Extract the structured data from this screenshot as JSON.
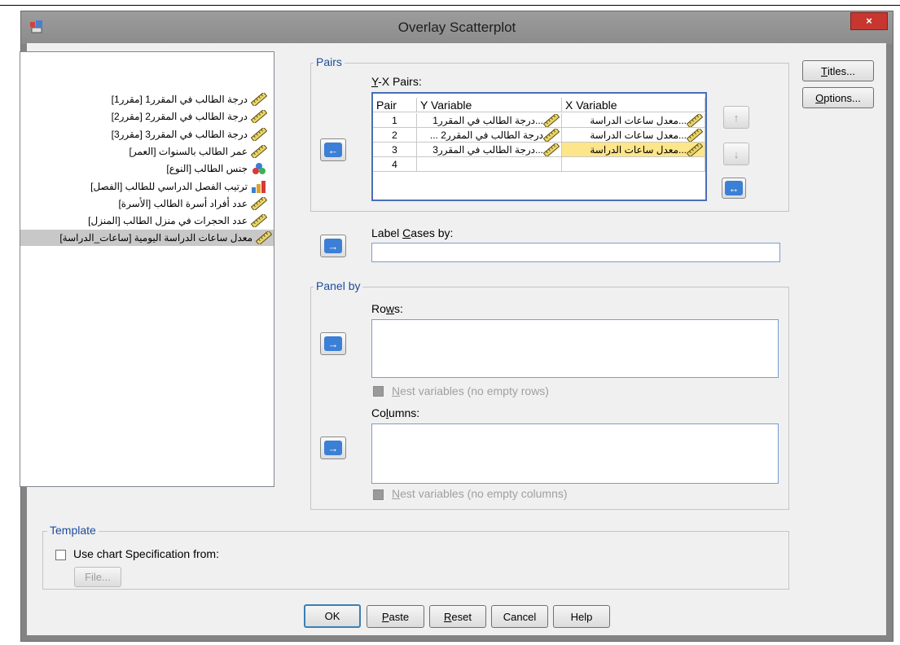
{
  "window": {
    "title": "Overlay Scatterplot",
    "close_label": "×"
  },
  "variables": [
    {
      "label": "درجة الطالب في المقرر1 [مقرر1]",
      "icon": "scale-ruler-icon",
      "selected": false
    },
    {
      "label": "درجة الطالب في المقرر2 [مقرر2]",
      "icon": "scale-ruler-icon",
      "selected": false
    },
    {
      "label": "درجة الطالب في المقرر3 [مقرر3]",
      "icon": "scale-ruler-icon",
      "selected": false
    },
    {
      "label": "عمر الطالب بالسنوات [العمر]",
      "icon": "scale-ruler-icon",
      "selected": false
    },
    {
      "label": "جنس الطالب [النوع]",
      "icon": "nominal-circles-icon",
      "selected": false
    },
    {
      "label": "ترتيب الفصل الدراسي للطالب [الفصل]",
      "icon": "ordinal-bars-icon",
      "selected": false
    },
    {
      "label": "عدد أفراد أسرة الطالب [الأسرة]",
      "icon": "scale-ruler-icon",
      "selected": false
    },
    {
      "label": "عدد الحجرات في منزل الطالب [المنزل]",
      "icon": "scale-ruler-icon",
      "selected": false
    },
    {
      "label": "معدل ساعات الدراسة اليومية [ساعات_الدراسة]",
      "icon": "scale-ruler-icon",
      "selected": true
    }
  ],
  "pairs": {
    "legend": "Pairs",
    "table_label_prefix": "Y",
    "table_label_rest": "-X Pairs:",
    "headers": {
      "pair": "Pair",
      "y": "Y Variable",
      "x": "X Variable"
    },
    "rows": [
      {
        "pair": "1",
        "y": "...درجة الطالب في المقرر1 ",
        "x": "...معدل ساعات الدراسة ",
        "highlight": false
      },
      {
        "pair": "2",
        "y": "درجة الطالب في المقرر2 ...",
        "x": "...معدل ساعات الدراسة ",
        "highlight": false
      },
      {
        "pair": "3",
        "y": "...درجة الطالب في المقرر3 ",
        "x": "...معدل ساعات الدراسة ",
        "highlight": true
      },
      {
        "pair": "4",
        "y": "",
        "x": "",
        "highlight": false
      }
    ],
    "up_label": "↑",
    "down_label": "↓",
    "swap_label": "↔",
    "move_label": "←"
  },
  "label_cases": {
    "prefix": "Label ",
    "accel": "C",
    "rest": "ases by:",
    "value": ""
  },
  "panel_by": {
    "legend": "Panel by",
    "rows_prefix": "Ro",
    "rows_accel": "w",
    "rows_rest": "s:",
    "nest_rows_accel": "N",
    "nest_rows_rest": "est variables (no empty rows)",
    "columns_prefix": "Co",
    "columns_accel": "l",
    "columns_rest": "umns:",
    "nest_cols_accel": "N",
    "nest_cols_rest": "est variables (no empty columns)",
    "move_label": "→"
  },
  "template": {
    "legend": "Template",
    "use_label": "Use chart Specification from:",
    "file_label": "File..."
  },
  "side_buttons": {
    "titles_accel": "T",
    "titles_rest": "itles...",
    "options_accel": "O",
    "options_rest": "ptions..."
  },
  "bottom_buttons": {
    "ok": "OK",
    "paste_accel": "P",
    "paste_rest": "aste",
    "reset_accel": "R",
    "reset_rest": "eset",
    "cancel": "Cancel",
    "help": "Help"
  },
  "colors": {
    "accent": "#3b7fd6",
    "highlight_row": "#fde58a",
    "selected_item": "#c8c8c8",
    "close": "#c7372f"
  }
}
